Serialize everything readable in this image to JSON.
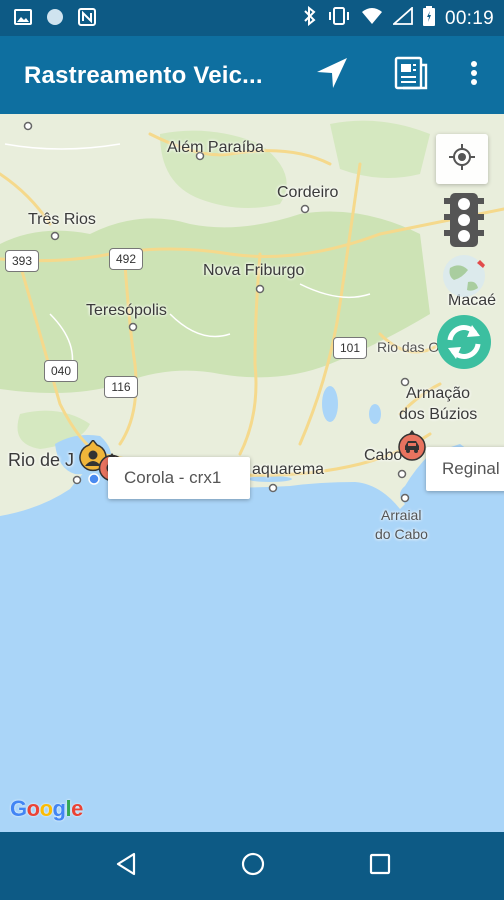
{
  "status_bar": {
    "time": "00:19",
    "icons": [
      "image-icon",
      "circle-icon",
      "nfc-icon",
      "bluetooth-icon",
      "vibrate-icon",
      "wifi-icon",
      "signal-icon",
      "battery-icon"
    ]
  },
  "app_bar": {
    "title": "Rastreamento Veic...",
    "actions": [
      "navigation-arrow-icon",
      "report-icon",
      "more-vert-icon"
    ]
  },
  "map": {
    "places": {
      "alem_paraiba": "Além Paraíba",
      "cordeiro": "Cordeiro",
      "tres_rios": "Três Rios",
      "nova_friburgo": "Nova Friburgo",
      "teresopolis": "Teresópolis",
      "macae": "Macaé",
      "rio_das_ostras": "Rio das O",
      "armacao_dos_buzios_1": "Armação",
      "armacao_dos_buzios_2": "dos Búzios",
      "rio_de_janeiro": "Rio de J",
      "saquarema": "aquarema",
      "cabo": "Cabo",
      "arraial_1": "Arraial",
      "arraial_2": "do Cabo"
    },
    "shields": {
      "r393": "393",
      "r492": "492",
      "r101": "101",
      "r040": "040",
      "r116": "116"
    },
    "info_windows": {
      "corola": "Corola - crx1",
      "reginal": "Reginal"
    },
    "logo": {
      "g1": "G",
      "o1": "o",
      "o2": "o",
      "g2": "g",
      "l": "l",
      "e": "e"
    },
    "colors": {
      "land": "#e9eedc",
      "forest": "#cde3b5",
      "water": "#aad5f8",
      "road": "#f5d98c",
      "refresh": "#3cbfa0",
      "marker_red": "#e8735f",
      "marker_yellow": "#f0b53a"
    }
  },
  "nav_bar": {
    "buttons": [
      "back-icon",
      "home-icon",
      "recents-icon"
    ]
  }
}
